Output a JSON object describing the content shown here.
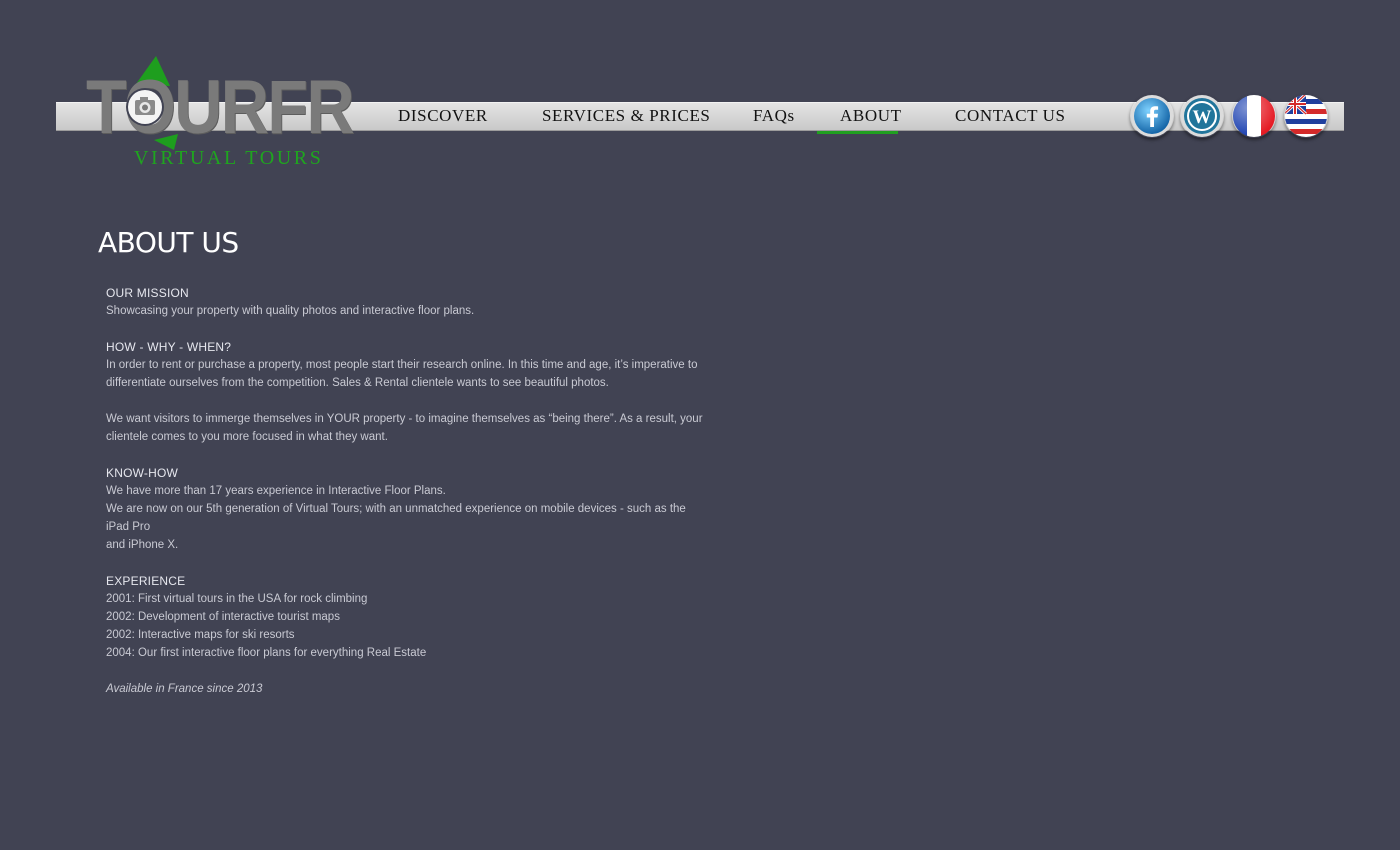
{
  "logo": {
    "wordmark": "TOURFR",
    "subtitle": "VIRTUAL TOURS"
  },
  "nav": {
    "items": [
      {
        "label": "DISCOVER"
      },
      {
        "label": "SERVICES & PRICES"
      },
      {
        "label": "FAQs"
      },
      {
        "label": "ABOUT",
        "active": true
      },
      {
        "label": "CONTACT US"
      }
    ]
  },
  "social": {
    "icons": [
      "facebook-icon",
      "wordpress-icon",
      "france-flag-icon",
      "hawaii-flag-icon"
    ]
  },
  "page": {
    "title": "ABOUT US",
    "sections": [
      {
        "heading": "OUR MISSION",
        "lines": [
          "Showcasing your property with quality photos and interactive floor plans."
        ]
      },
      {
        "heading": "HOW - WHY - WHEN?",
        "lines": [
          "In order to rent or purchase a property, most people start their research online. In this time and age, it’s imperative to",
          "differentiate ourselves from the competition. Sales & Rental clientele wants to see beautiful photos."
        ],
        "extra_lines": [
          "We want visitors to immerge themselves in YOUR property - to imagine themselves as “being there”.  As a result, your",
          "clientele comes to you more focused in what they want."
        ]
      },
      {
        "heading": "KNOW-HOW",
        "lines": [
          "We have more than 17 years experience in Interactive Floor Plans.",
          "We are now on our 5th generation of Virtual Tours; with an unmatched experience on mobile devices - such as the iPad Pro",
          "and iPhone X."
        ]
      },
      {
        "heading": "EXPERIENCE",
        "lines": [
          "2001: First virtual tours in the USA for rock climbing",
          "2002: Development of interactive tourist maps",
          "2002: Interactive maps for ski resorts",
          "2004: Our first interactive floor plans for everything Real Estate"
        ]
      }
    ],
    "footnote": "Available in France since 2013"
  },
  "colors": {
    "background": "#414353",
    "accent_green": "#1fa51f",
    "nav_bar": "#d6d6d6",
    "text": "#c9cad3"
  }
}
